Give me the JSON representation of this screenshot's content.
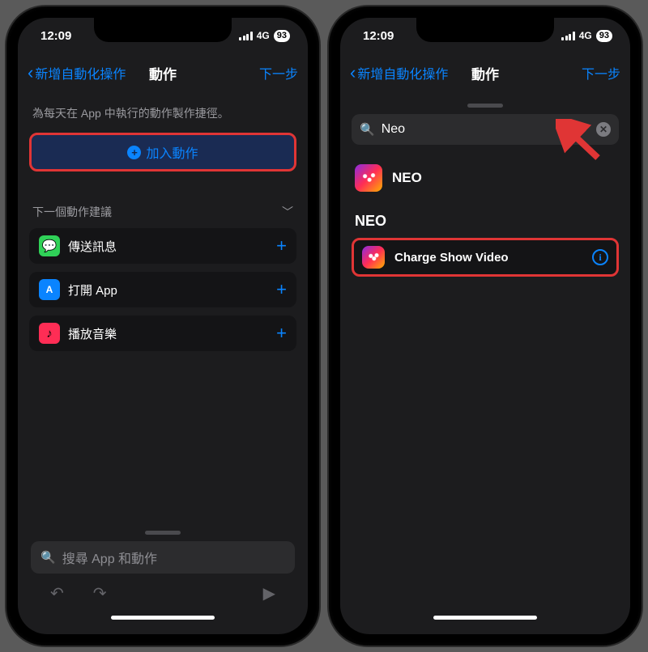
{
  "status": {
    "time": "12:09",
    "network": "4G",
    "battery": "93"
  },
  "nav": {
    "back": "新增自動化操作",
    "title": "動作",
    "next": "下一步"
  },
  "left": {
    "intro": "為每天在 App 中執行的動作製作捷徑。",
    "add_action": "加入動作",
    "suggestions_header": "下一個動作建議",
    "suggestions": [
      {
        "label": "傳送訊息",
        "iconGlyph": "💬"
      },
      {
        "label": "打開 App",
        "iconGlyph": "A"
      },
      {
        "label": "播放音樂",
        "iconGlyph": "♪"
      }
    ],
    "search_placeholder": "搜尋 App 和動作"
  },
  "right": {
    "search_value": "Neo",
    "app_result_label": "NEO",
    "section_title": "NEO",
    "action_label": "Charge Show Video"
  }
}
